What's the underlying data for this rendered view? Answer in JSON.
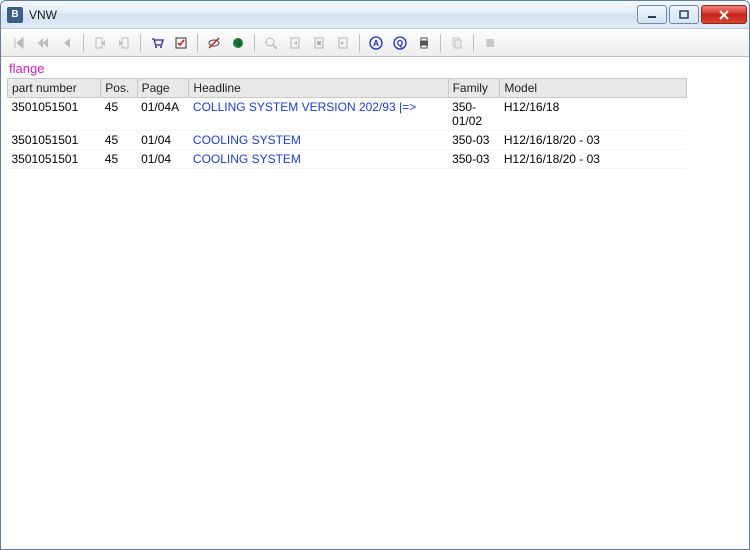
{
  "window": {
    "title": "VNW",
    "app_icon_letter": "B"
  },
  "section": {
    "title": "flange"
  },
  "columns": {
    "part_number": "part number",
    "pos": "Pos.",
    "page": "Page",
    "headline": "Headline",
    "family": "Family",
    "model": "Model"
  },
  "rows": [
    {
      "part_number": "3501051501",
      "pos": "45",
      "page": "01/04A",
      "headline": "COLLING SYSTEM  VERSION 202/93 |=>",
      "family": "350-01/02",
      "model": "H12/16/18"
    },
    {
      "part_number": "3501051501",
      "pos": "45",
      "page": "01/04",
      "headline": "COOLING SYSTEM",
      "family": "350-03",
      "model": "H12/16/18/20 - 03"
    },
    {
      "part_number": "3501051501",
      "pos": "45",
      "page": "01/04",
      "headline": "COOLING SYSTEM",
      "family": "350-03",
      "model": "H12/16/18/20 - 03"
    }
  ]
}
